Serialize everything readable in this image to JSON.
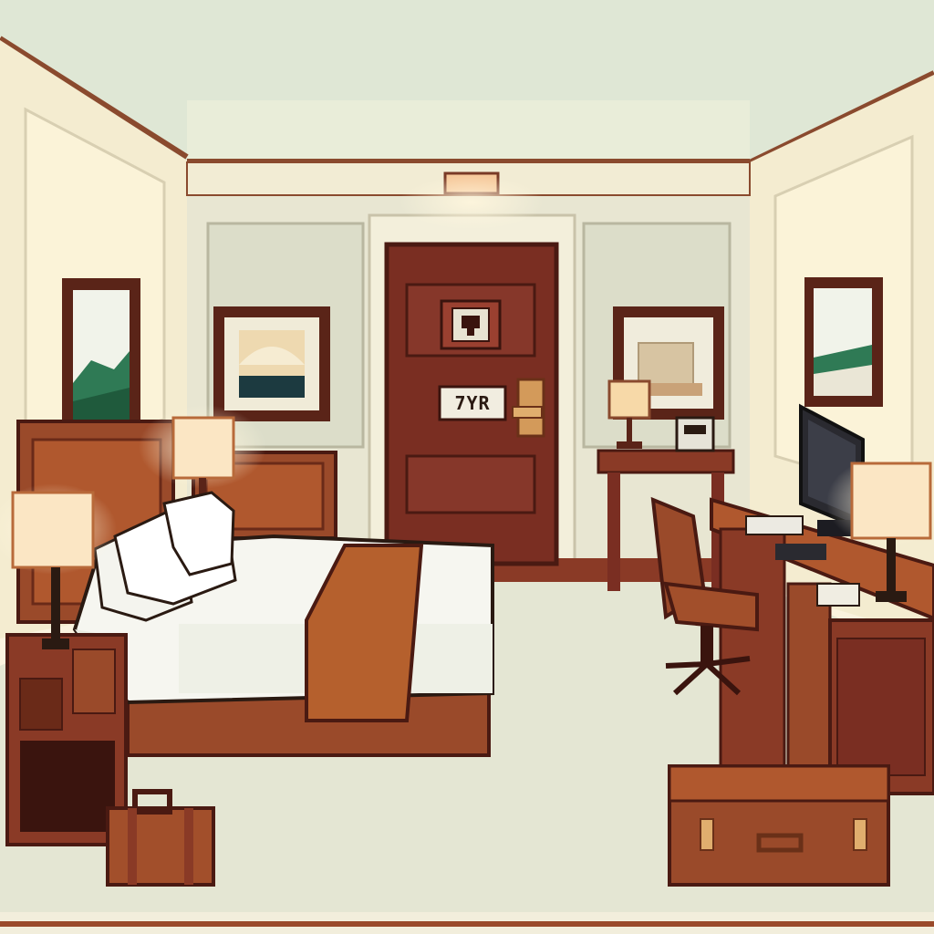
{
  "scene": "hotel-room",
  "room_number_plate": "7YR",
  "colors": {
    "ceiling": "#e2ead8",
    "wall": "#f7efcf",
    "wall_panel": "#dfe0cd",
    "trim": "#8a4a2e",
    "door": "#7a2e22",
    "wood": "#9a4a2a",
    "wood_light": "#b8642f",
    "bedding": "#f6f6f0",
    "bed_runner": "#b5602d",
    "carpet": "#e6e7d3",
    "lamp_glow": "#fbe6c4"
  },
  "icons": [
    "lock-keypad-icon",
    "door-handle-icon",
    "monitor-icon",
    "phone-icon"
  ]
}
